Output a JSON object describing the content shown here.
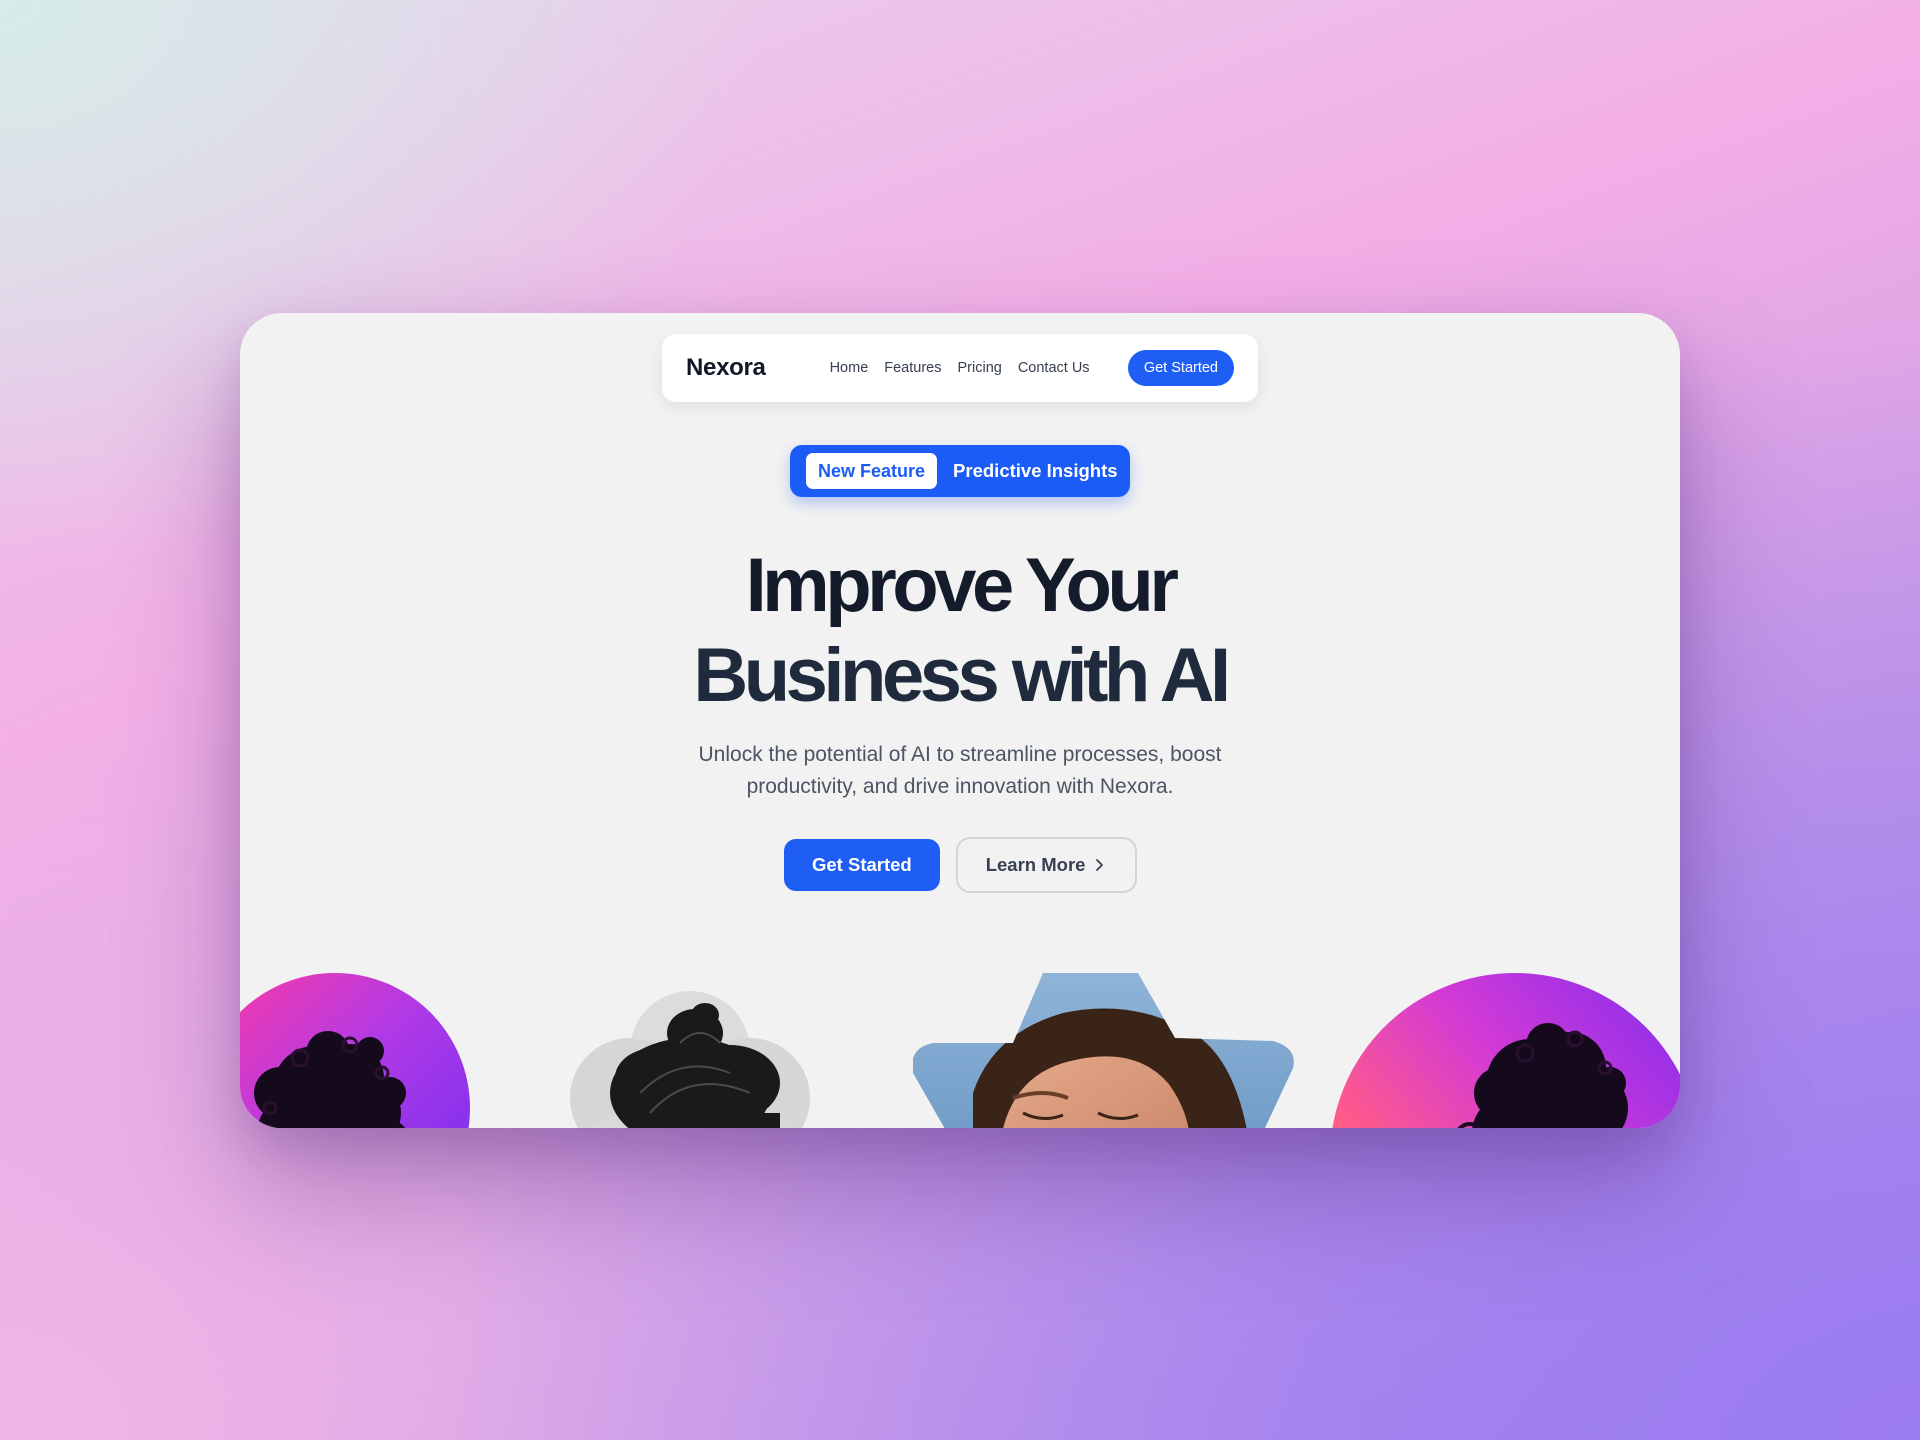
{
  "brand": {
    "name": "Nexora"
  },
  "nav": {
    "links": [
      "Home",
      "Features",
      "Pricing",
      "Contact Us"
    ],
    "cta_label": "Get Started"
  },
  "badge": {
    "pill_label": "New Feature",
    "text": "Predictive Insights"
  },
  "hero": {
    "headline_line1": "Improve Your",
    "headline_line2": "Business with AI",
    "subtitle": "Unlock the potential of AI to streamline processes, boost productivity, and drive innovation with Nexora.",
    "primary_cta": "Get Started",
    "secondary_cta": "Learn More"
  },
  "gallery": {
    "items": [
      "portrait-curly-hair-gradient",
      "portrait-grayscale-flower-shape",
      "portrait-woman-eyes-closed-star-shape",
      "portrait-glasses-gradient"
    ]
  },
  "colors": {
    "accent": "#1e5ef5",
    "card_background": "#f2f2f2",
    "headline": "#141c2c"
  }
}
